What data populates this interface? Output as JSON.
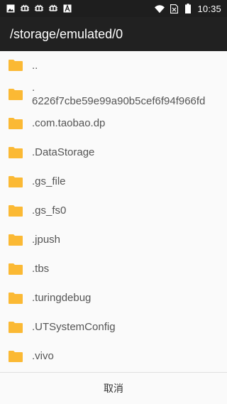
{
  "status_bar": {
    "time": "10:35",
    "icons_left": [
      "image-icon",
      "notification-bug-icon",
      "notification-bug-icon",
      "notification-bug-icon",
      "a-icon"
    ],
    "icons_right": [
      "wifi-icon",
      "sim-icon",
      "battery-icon"
    ]
  },
  "app_bar": {
    "path": "/storage/emulated/0"
  },
  "files": [
    {
      "name": "..",
      "icon": "folder-icon"
    },
    {
      "name_line1": ".",
      "name_line2": "6226f7cbe59e99a90b5cef6f94f966fd",
      "icon": "folder-icon"
    },
    {
      "name": ".com.taobao.dp",
      "icon": "folder-icon"
    },
    {
      "name": ".DataStorage",
      "icon": "folder-icon"
    },
    {
      "name": ".gs_file",
      "icon": "folder-icon"
    },
    {
      "name": ".gs_fs0",
      "icon": "folder-icon"
    },
    {
      "name": ".jpush",
      "icon": "folder-icon"
    },
    {
      "name": ".tbs",
      "icon": "folder-icon"
    },
    {
      "name": ".turingdebug",
      "icon": "folder-icon"
    },
    {
      "name": ".UTSystemConfig",
      "icon": "folder-icon"
    },
    {
      "name": ".vivo",
      "icon": "folder-icon"
    }
  ],
  "footer": {
    "cancel_label": "取消"
  },
  "colors": {
    "status_bar": "#1e1e1e",
    "app_bar": "#212121",
    "folder": "#fbb934",
    "background": "#fafafa"
  }
}
